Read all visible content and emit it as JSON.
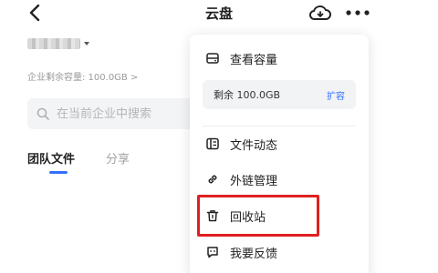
{
  "header": {
    "title": "云盘",
    "back_icon": "chevron-left-icon",
    "cloud_icon": "cloud-sync-icon",
    "more_icon": "more-horizontal-icon"
  },
  "account": {
    "capacity_text": "企业剩余容量: 100.0GB >"
  },
  "search": {
    "placeholder": "在当前企业中搜索"
  },
  "tabs": [
    {
      "label": "团队文件",
      "active": true
    },
    {
      "label": "分享",
      "active": false
    }
  ],
  "menu": {
    "view_capacity": {
      "label": "查看容量",
      "icon": "storage-icon"
    },
    "quota": {
      "text": "剩余 100.0GB",
      "action": "扩容"
    },
    "items": [
      {
        "label": "文件动态",
        "icon": "file-activity-icon"
      },
      {
        "label": "外链管理",
        "icon": "link-icon"
      },
      {
        "label": "回收站",
        "icon": "trash-icon",
        "highlighted": true
      },
      {
        "label": "我要反馈",
        "icon": "feedback-icon"
      }
    ]
  },
  "colors": {
    "accent": "#3370ff",
    "highlight_border": "#e02020"
  }
}
